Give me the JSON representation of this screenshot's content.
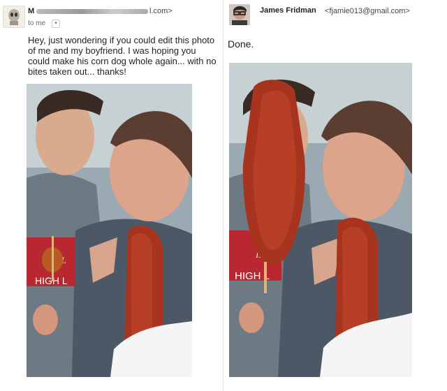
{
  "left_email": {
    "sender_initial": "M",
    "sender_domain": "l.com>",
    "recipient_label": "to me",
    "dropdown_icon": "chevron-down-icon",
    "message": "Hey, just wondering if you could edit this photo of me and my boyfriend. I was hoping you could make his corn dog whole again... with no bites taken out... thanks!",
    "photo_text": [
      "ILL",
      "HIGH L"
    ]
  },
  "right_email": {
    "sender_name": "James Fridman",
    "sender_email": "<fjamie013@gmail.com>",
    "message": "Done.",
    "photo_text": [
      "ILL",
      "HIGH L"
    ]
  },
  "colors": {
    "corn_dog": "#a7341f",
    "corn_dog_highlight": "#c5482b",
    "shirt_gray": "#707b84",
    "skin": "#d7a58c",
    "background_divider": "#e6e6e6"
  }
}
